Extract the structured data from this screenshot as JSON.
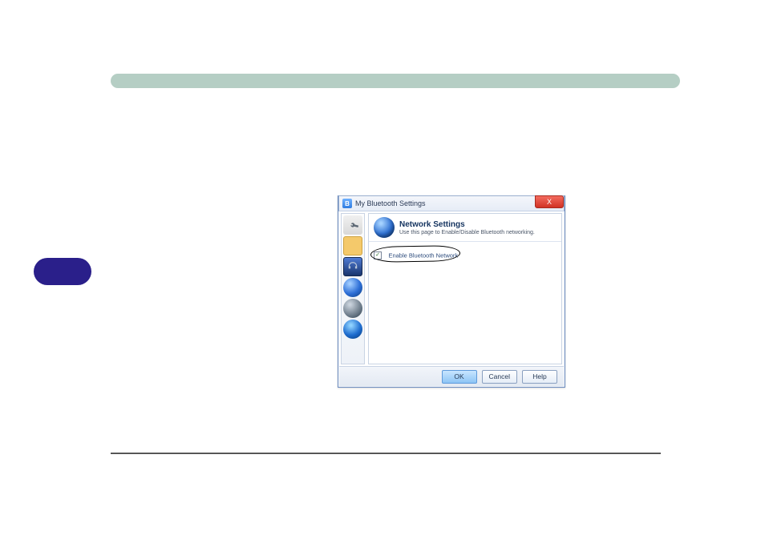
{
  "dialog": {
    "title": "My Bluetooth Settings",
    "close_x": "X",
    "header": {
      "title": "Network Settings",
      "subtitle": "Use this page to Enable/Disable Bluetooth networking."
    },
    "checkbox": {
      "label": "Enable Bluetooth Network",
      "checked": "✓"
    },
    "buttons": {
      "ok": "OK",
      "cancel": "Cancel",
      "help": "Help"
    },
    "sidebar_icons": [
      "wrench-icon",
      "folder-icon",
      "headset-icon",
      "network-globe-icon",
      "speaker-icon",
      "internet-globe-icon"
    ]
  }
}
